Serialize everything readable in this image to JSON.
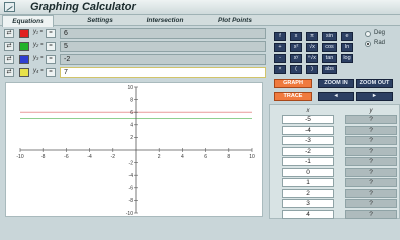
{
  "window": {
    "title": "Graphing Calculator"
  },
  "tabs": [
    {
      "label": "Equations"
    },
    {
      "label": "Settings"
    },
    {
      "label": "Intersection"
    },
    {
      "label": "Plot Points"
    }
  ],
  "equations": [
    {
      "label": "y₁ =",
      "eq_button": "=",
      "value": "6",
      "color": "#e02020"
    },
    {
      "label": "y₂ =",
      "eq_button": "=",
      "value": "5",
      "color": "#22b22a"
    },
    {
      "label": "y₃ =",
      "eq_button": "=",
      "value": "-2",
      "color": "#2f3fd0"
    },
    {
      "label": "y₄ =",
      "eq_button": "=",
      "value": "7",
      "color": "#e8e24a"
    }
  ],
  "keypad": {
    "rows": [
      [
        "f",
        "x",
        "π",
        "sin",
        "e"
      ],
      [
        "+",
        "x²",
        "√x",
        "cos",
        "ln"
      ],
      [
        "-",
        "xʸ",
        "ⁿ√x",
        "tan",
        "log"
      ],
      [
        "×",
        "(",
        ")",
        "abs"
      ]
    ]
  },
  "angle_mode": {
    "options": [
      "Deg",
      "Rad"
    ],
    "selected": "Rad"
  },
  "buttons": {
    "graph": "GRAPH",
    "zoom_in": "ZOOM IN",
    "zoom_out": "ZOOM OUT",
    "trace": "TRACE",
    "left_arrow": "◄",
    "right_arrow": "►"
  },
  "table": {
    "x_header": "x",
    "y_header": "y",
    "x_values": [
      "-5",
      "-4",
      "-3",
      "-2",
      "-1",
      "0",
      "1",
      "2",
      "3",
      "4"
    ],
    "y_values": [
      "?",
      "?",
      "?",
      "?",
      "?",
      "?",
      "?",
      "?",
      "?",
      "?"
    ]
  },
  "chart_data": {
    "type": "line",
    "xlim": [
      -10,
      10
    ],
    "ylim": [
      -10,
      10
    ],
    "x_ticks": [
      -10,
      -8,
      -6,
      -4,
      -2,
      2,
      4,
      6,
      8,
      10
    ],
    "y_ticks": [
      -10,
      -8,
      -6,
      -4,
      -2,
      2,
      4,
      6,
      8,
      10
    ],
    "series": [
      {
        "kind": "horizontal",
        "y": 6,
        "color": "#e89a9a"
      },
      {
        "kind": "horizontal",
        "y": 5,
        "color": "#8fcf8f"
      }
    ]
  }
}
